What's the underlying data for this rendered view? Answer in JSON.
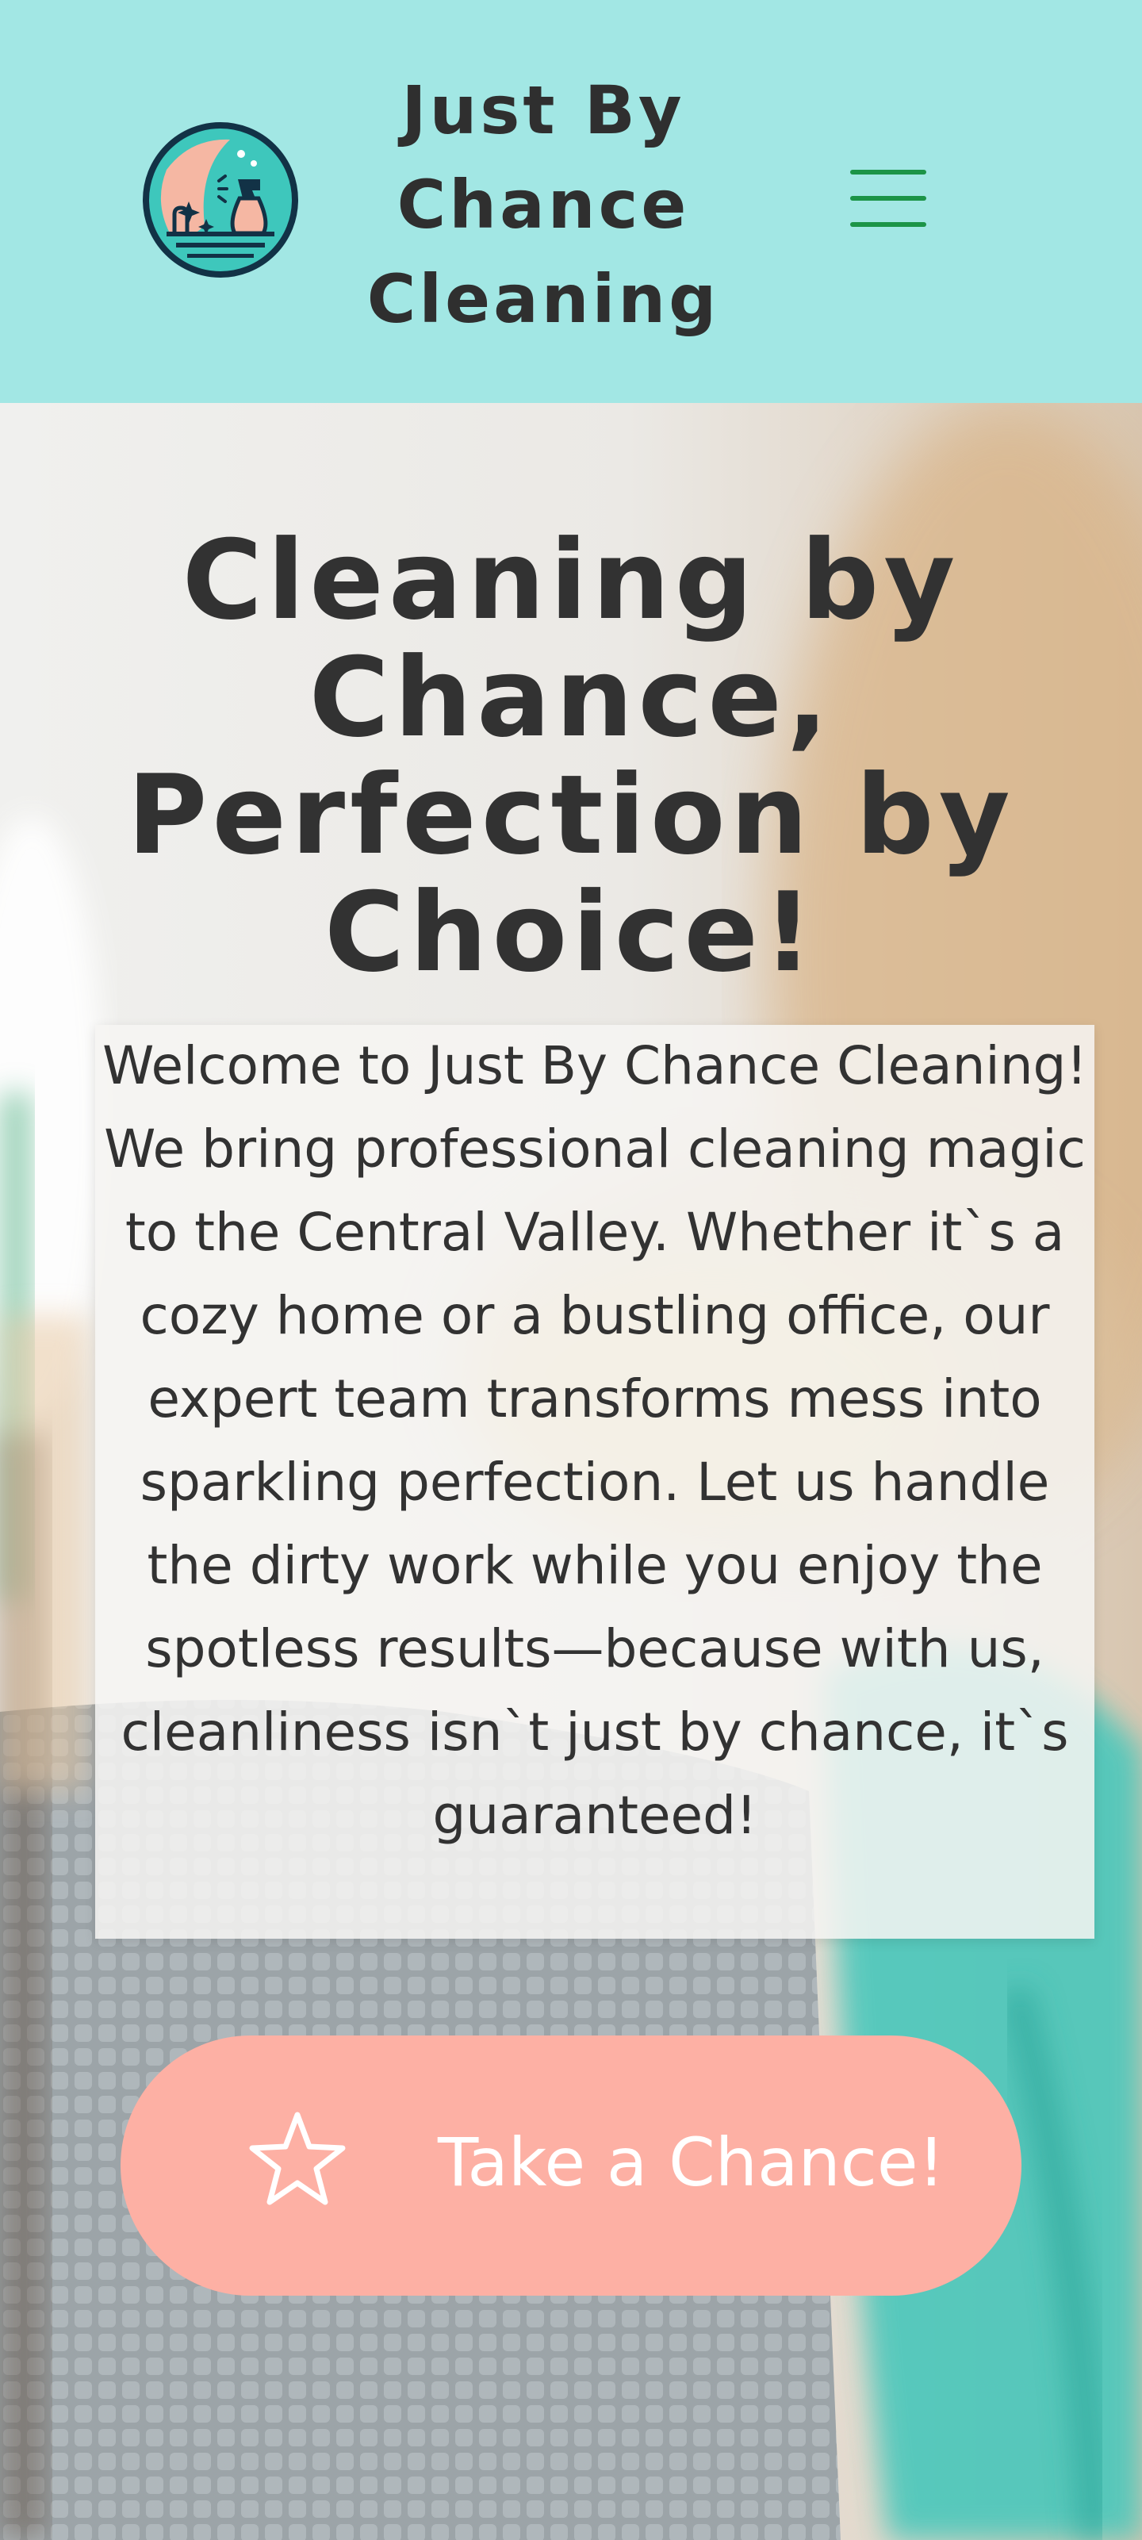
{
  "header": {
    "brand_name": "Just By Chance Cleaning",
    "logo_icon": "spray-bottle-logo-icon",
    "menu_icon": "hamburger-menu-icon",
    "background_color": "#a2e7e4",
    "menu_color": "#1c9447"
  },
  "hero": {
    "title": "Cleaning by Chance, Perfection by Choice!",
    "welcome_text": "Welcome to Just By Chance Cleaning! We bring professional cleaning magic to the Central Valley. Whether it`s a cozy home or a bustling office, our expert team transforms mess into sparkling perfection. Let us handle the dirty work while you enjoy the spotless results—because with us, cleanliness isn`t just by chance, it`s guaranteed!",
    "cta_label": "Take a Chance!",
    "cta_icon": "star-icon",
    "cta_color": "#fdb0a4",
    "background_image": "cleaning-supplies-photo"
  }
}
